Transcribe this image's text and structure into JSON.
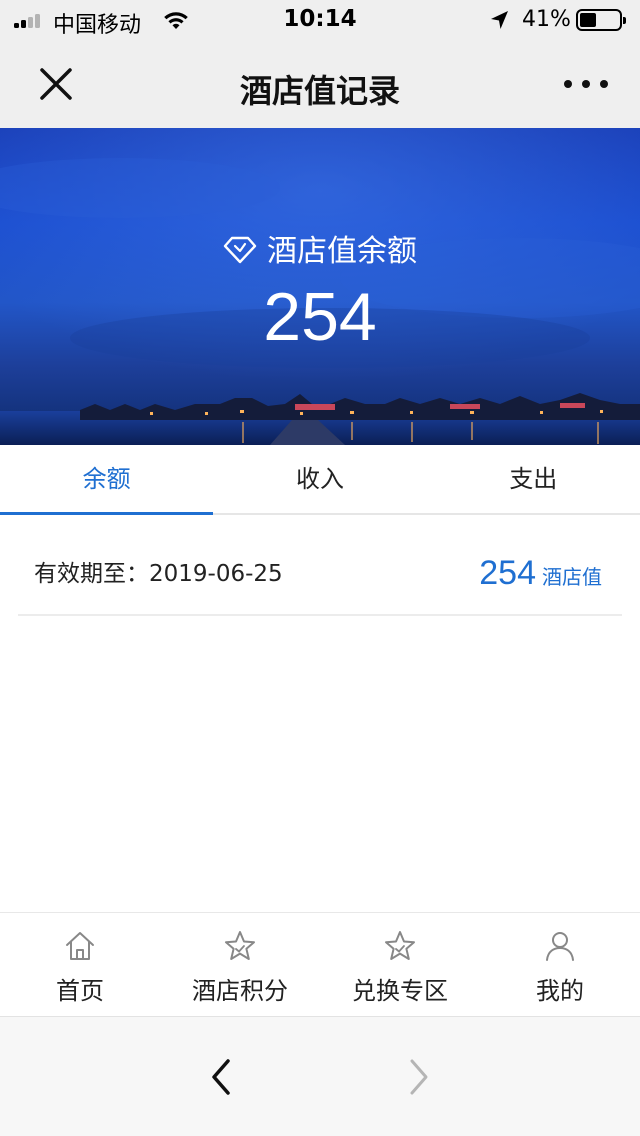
{
  "status_bar": {
    "carrier": "中国移动",
    "time": "10:14",
    "battery": "41%",
    "battery_level": 0.41
  },
  "nav": {
    "title": "酒店值记录",
    "close_icon": "close-icon",
    "more_icon": "more-icon"
  },
  "hero": {
    "label": "酒店值余额",
    "value": "254",
    "icon": "gem-icon"
  },
  "tabs": [
    {
      "label": "余额",
      "active": true
    },
    {
      "label": "收入",
      "active": false
    },
    {
      "label": "支出",
      "active": false
    }
  ],
  "record": {
    "label": "有效期至：2019-06-25",
    "amount": "254",
    "unit": "酒店值"
  },
  "bottom_nav": [
    {
      "label": "首页",
      "icon": "home-icon"
    },
    {
      "label": "酒店积分",
      "icon": "star-icon"
    },
    {
      "label": "兑换专区",
      "icon": "star-icon"
    },
    {
      "label": "我的",
      "icon": "user-icon"
    }
  ],
  "colors": {
    "accent": "#1f6fd1",
    "bar_bg": "#efefef",
    "hero_blue": "#1b4ed0"
  }
}
